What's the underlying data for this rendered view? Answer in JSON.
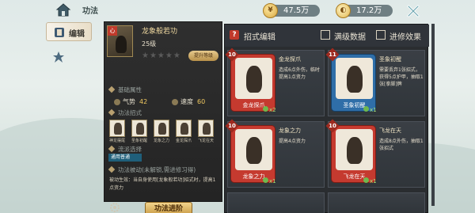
{
  "top_bar": {
    "title": "功法",
    "currency1": {
      "value": "47.5万",
      "icon": "coin-icon"
    },
    "currency2": {
      "value": "17.2万",
      "icon": "jade-icon"
    }
  },
  "left_nav": {
    "items": [
      {
        "label": "编辑",
        "active": true,
        "icon": "book-icon"
      },
      {
        "label": "",
        "active": false,
        "icon": "emblem-icon"
      }
    ]
  },
  "skill_panel": {
    "avatar_badge": "心",
    "name": "龙象般若功",
    "level": "25级",
    "stars_filled": 0,
    "stars_total": 5,
    "upgrade_button": "提升等级",
    "attr_section": "基础属性",
    "attrs": [
      {
        "label": "气势",
        "value": "42"
      },
      {
        "label": "速度",
        "value": "60"
      }
    ],
    "moves_section": "功法招式",
    "moves": [
      "神龙摆尾",
      "圣象初醒",
      "龙象之力",
      "金龙探爪",
      "飞龙在天"
    ],
    "follow_section": "流派选择",
    "follow_tag": "通用普通",
    "passive_section": "功法被动(未解锁,需进修习得)",
    "description": "被动生效：当自身使用[龙象般若功]招式时，提高1点资力",
    "gear_label": "装备",
    "main_button": "功法进阶"
  },
  "edit_panel": {
    "title": "招式编辑",
    "check1": "满级数据",
    "check2": "进修效果",
    "cards": [
      {
        "cost": "10",
        "art_name": "金龙探爪",
        "title": "金龙探爪",
        "desc": "造成6点外伤，临时提高1点资力",
        "count": "x2",
        "frame": "#c53a2f"
      },
      {
        "cost": "11",
        "art_name": "圣象初醒",
        "title": "圣象初醒",
        "desc": "需要丢弃1张招式，获得5点护甲，抽取1张[拳脚]牌",
        "count": "x1",
        "frame": "#2f6ea8"
      },
      {
        "cost": "10",
        "art_name": "龙象之力",
        "title": "龙象之力",
        "desc": "提高4点资力",
        "count": "x1",
        "frame": "#c53a2f"
      },
      {
        "cost": "10",
        "art_name": "飞龙在天",
        "title": "飞龙在天",
        "desc": "造成8点外伤，抽取1张招式",
        "count": "x1",
        "frame": "#c53a2f"
      }
    ]
  }
}
